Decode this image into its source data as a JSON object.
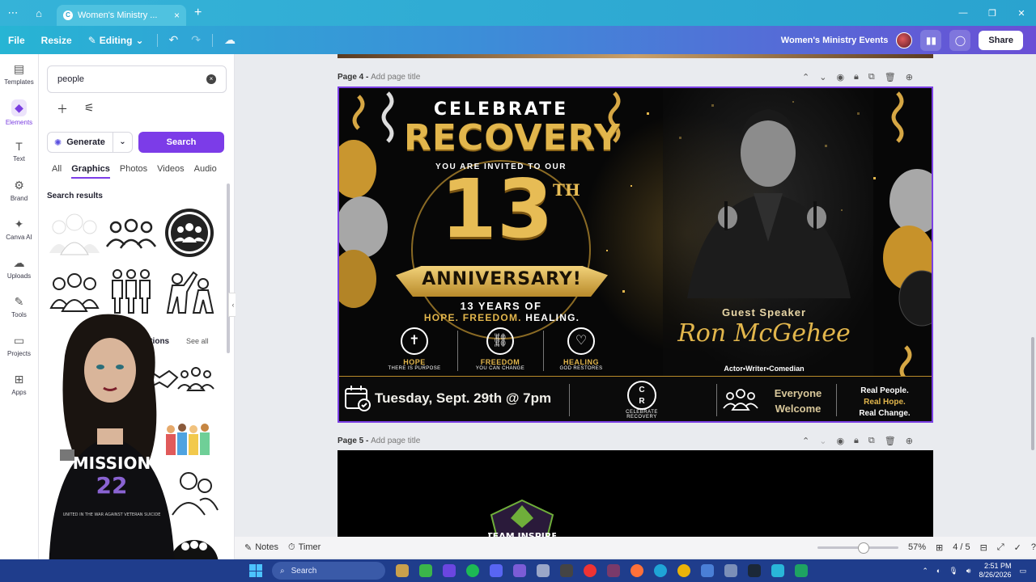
{
  "browser": {
    "tab_title": "Women's Ministry ...",
    "tab_close": "×",
    "new_tab": "+",
    "menu_icon": "⋯",
    "home_icon": "⌂",
    "window_controls": [
      "—",
      "❐",
      "✕"
    ]
  },
  "toolbar": {
    "file": "File",
    "resize": "Resize",
    "editing": "Editing",
    "project_title": "Women's Ministry Events",
    "share": "Share"
  },
  "rail": [
    {
      "label": "Templates",
      "icon": "▤"
    },
    {
      "label": "Elements",
      "icon": "◆"
    },
    {
      "label": "Text",
      "icon": "T"
    },
    {
      "label": "Brand",
      "icon": "⚙"
    },
    {
      "label": "Canva AI",
      "icon": "✦"
    },
    {
      "label": "Uploads",
      "icon": "☁"
    },
    {
      "label": "Tools",
      "icon": "✎"
    },
    {
      "label": "Projects",
      "icon": "▭"
    },
    {
      "label": "Apps",
      "icon": "⊞"
    }
  ],
  "panel": {
    "search_value": "people",
    "generate": "Generate",
    "search": "Search",
    "filters": [
      "All",
      "Graphics",
      "Photos",
      "Videos",
      "Audio"
    ],
    "active_filter": "Graphics",
    "results_title": "Search results",
    "recommendations": "ommendations",
    "see_all": "See all"
  },
  "pages": {
    "page4_label": "Page 4 - ",
    "page5_label": "Page 5 - ",
    "add_title": "Add page title"
  },
  "design": {
    "celebrate": "CELEBRATE",
    "recovery": "RECOVERY",
    "invited": "YOU ARE INVITED TO OUR",
    "number": "13",
    "ordinal": "TH",
    "anniversary": "ANNIVERSARY!",
    "years": "13 YEARS OF",
    "hope_freedom": "HOPE. FREEDOM. ",
    "healing": "HEALING.",
    "pillars": [
      {
        "title": "HOPE",
        "sub": "THERE IS PURPOSE",
        "glyph": "✝"
      },
      {
        "title": "FREEDOM",
        "sub": "YOU CAN CHANGE",
        "glyph": "⛓"
      },
      {
        "title": "HEALING",
        "sub": "GOD RESTORES",
        "glyph": "♡"
      }
    ],
    "guest_speaker": "Guest Speaker",
    "speaker_name": "Ron McGehee",
    "speaker_role": "Actor•Writer•Comedian",
    "date": "Tuesday, Sept. 29th @ 7pm",
    "logo_text": "C\nR",
    "logo_caption": "CELEBRATE RECOVERY",
    "everyone": "Everyone",
    "welcome": "Welcome",
    "real_people": "Real People.",
    "real_hope": "Real Hope.",
    "real_change": "Real Change."
  },
  "overlay": {
    "shirt_title": "MISSION",
    "shirt_number": "22",
    "shirt_tagline": "UNITED IN THE WAR AGAINST VETERAN SUICIDE",
    "logo_text": "TEAM INSPIRE"
  },
  "bottombar": {
    "notes": "Notes",
    "timer": "Timer",
    "zoom": "57%",
    "zoom_fraction": 0.57,
    "pages": "4 / 5"
  },
  "taskbar": {
    "search": "Search",
    "time": "2:51 PM",
    "date": "8/26/2026"
  },
  "colors": {
    "accent": "#7c3ce8",
    "gold": "#e2b64c"
  }
}
